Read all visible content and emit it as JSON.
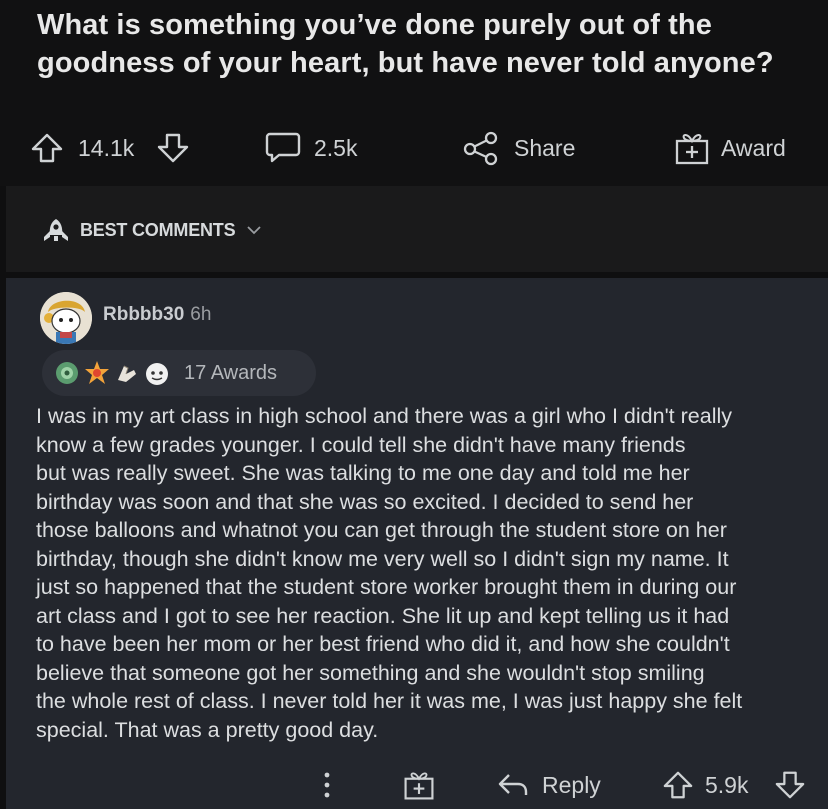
{
  "post": {
    "title_line1": "What is something you’ve done purely out of the",
    "title_line2": "goodness of your heart, but have never told anyone?"
  },
  "actions": {
    "upvotes": "14.1k",
    "comments": "2.5k",
    "share_label": "Share",
    "award_label": "Award"
  },
  "sort": {
    "label": "BEST COMMENTS"
  },
  "comment": {
    "username": "Rbbbb30",
    "age": "6h",
    "awards_label": "17 Awards",
    "body_lines": [
      "I was in my art class in high school and there was a girl who I didn't really",
      "know a few grades younger. I could tell she didn't have many friends",
      "but was really sweet. She was talking to me one day and told me her",
      "birthday was soon and that she was so excited. I decided to send her",
      "those balloons and whatnot you can get through the student store on her",
      "birthday, though she didn't know me very well so I didn't sign my name. It",
      "just so happened that the student store worker brought them in during our",
      "art class and I got to see her reaction. She lit up and kept telling us it had",
      "to have been her mom or her best friend who did it, and how she couldn't",
      "believe that someone got her something and she wouldn't stop smiling",
      "the whole rest of class. I never told her it was me, I was just happy she felt",
      "special. That was a pretty good day."
    ],
    "reply_label": "Reply",
    "votes": "5.9k"
  },
  "icons": {
    "upvote": "upvote-icon",
    "downvote": "downvote-icon",
    "comment": "comment-icon",
    "share": "share-icon",
    "award": "award-icon",
    "sort": "rocket-icon",
    "chevron": "chevron-down-icon",
    "more": "more-vertical-icon",
    "reply": "reply-icon"
  },
  "colors": {
    "background": "#0f0f10",
    "sort_bar": "#1a1a1b",
    "comment_bg": "#23262d",
    "text": "#d7dadc"
  }
}
